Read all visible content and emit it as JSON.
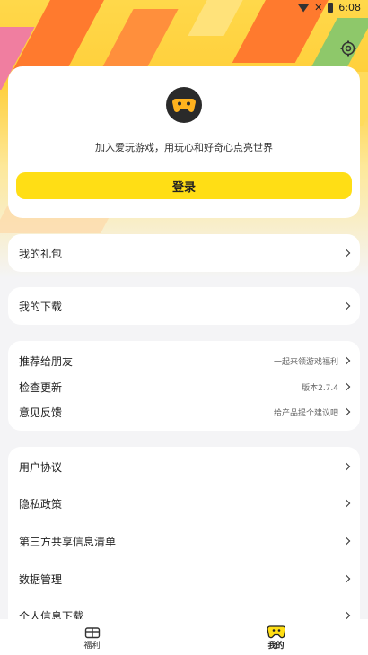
{
  "status_bar": {
    "time": "6:08"
  },
  "icons": {
    "settings": "settings-gear-icon",
    "logo": "gamepad-icon",
    "chevron": "chevron-right-icon",
    "welfare": "gift-box-icon",
    "mine": "gamepad-face-icon"
  },
  "colors": {
    "accent": "#ffde15",
    "hero_orange": "#ff7a2e",
    "hero_yellow": "#ffd84a",
    "background": "#f4f4f6"
  },
  "login_card": {
    "tagline": "加入爱玩游戏，用玩心和好奇心点亮世界",
    "login_label": "登录"
  },
  "menu": {
    "gift": {
      "label": "我的礼包"
    },
    "download": {
      "label": "我的下载"
    },
    "group2": [
      {
        "label": "推荐给朋友",
        "hint": "一起来领游戏福利"
      },
      {
        "label": "检查更新",
        "hint": "版本2.7.4"
      },
      {
        "label": "意见反馈",
        "hint": "给产品提个建议吧"
      }
    ],
    "group3": [
      {
        "label": "用户协议"
      },
      {
        "label": "隐私政策"
      },
      {
        "label": "第三方共享信息清单"
      },
      {
        "label": "数据管理"
      },
      {
        "label": "个人信息下载"
      }
    ]
  },
  "tabbar": {
    "tabs": [
      {
        "label": "福利"
      },
      {
        "label": "我的"
      }
    ]
  }
}
